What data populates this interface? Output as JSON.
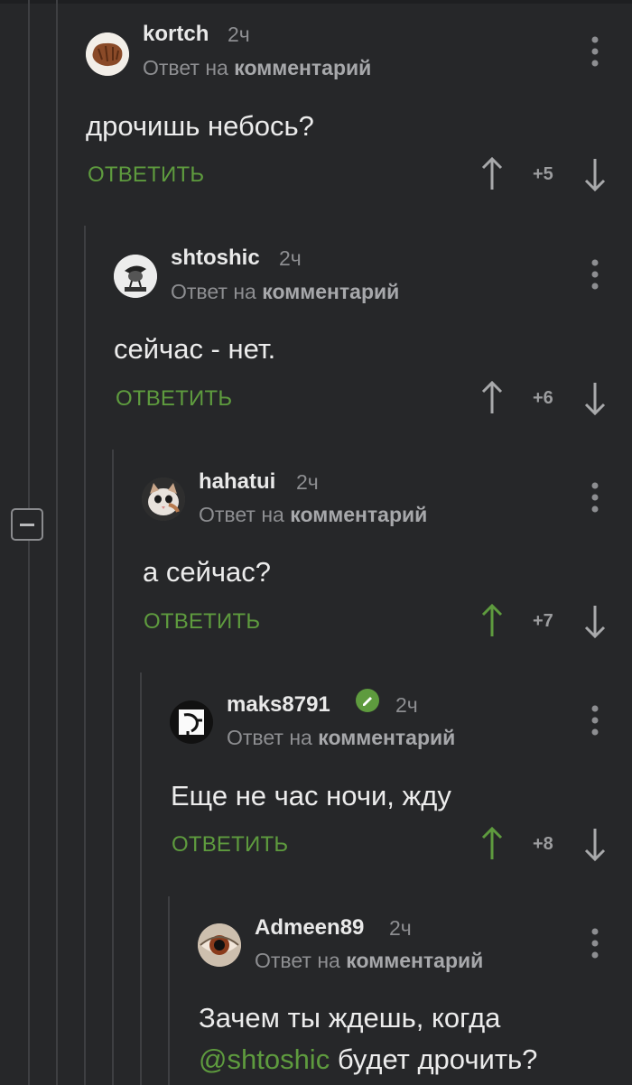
{
  "comments": [
    {
      "author": "kortch",
      "time": "2ч",
      "reply_prefix": "Ответ на",
      "reply_target": "комментарий",
      "text": "дрочишь небось?",
      "reply_label": "ОТВЕТИТЬ",
      "rating": "+5",
      "upvoted": false
    },
    {
      "author": "shtoshic",
      "time": "2ч",
      "reply_prefix": "Ответ на",
      "reply_target": "комментарий",
      "text": "сейчас - нет.",
      "reply_label": "ОТВЕТИТЬ",
      "rating": "+6",
      "upvoted": false
    },
    {
      "author": "hahatui",
      "time": "2ч",
      "reply_prefix": "Ответ на",
      "reply_target": "комментарий",
      "text": "а сейчас?",
      "reply_label": "ОТВЕТИТЬ",
      "rating": "+7",
      "upvoted": true
    },
    {
      "author": "maks8791",
      "time": "2ч",
      "verified": true,
      "reply_prefix": "Ответ на",
      "reply_target": "комментарий",
      "text": "Еще не час ночи, жду",
      "reply_label": "ОТВЕТИТЬ",
      "rating": "+8",
      "upvoted": true
    },
    {
      "author": "Admeen89",
      "time": "2ч",
      "reply_prefix": "Ответ на",
      "reply_target": "комментарий",
      "text_line1": "Зачем ты ждешь, когда",
      "mention": "@shtoshic",
      "text_line2_rest": " будет дрочить?"
    }
  ],
  "colors": {
    "accent": "#5e9b3e",
    "background": "#262729",
    "muted": "#8d8e91"
  },
  "icons": {
    "menu": "more-vertical-icon",
    "up": "arrow-up-icon",
    "down": "arrow-down-icon",
    "verified": "verified-icon"
  }
}
